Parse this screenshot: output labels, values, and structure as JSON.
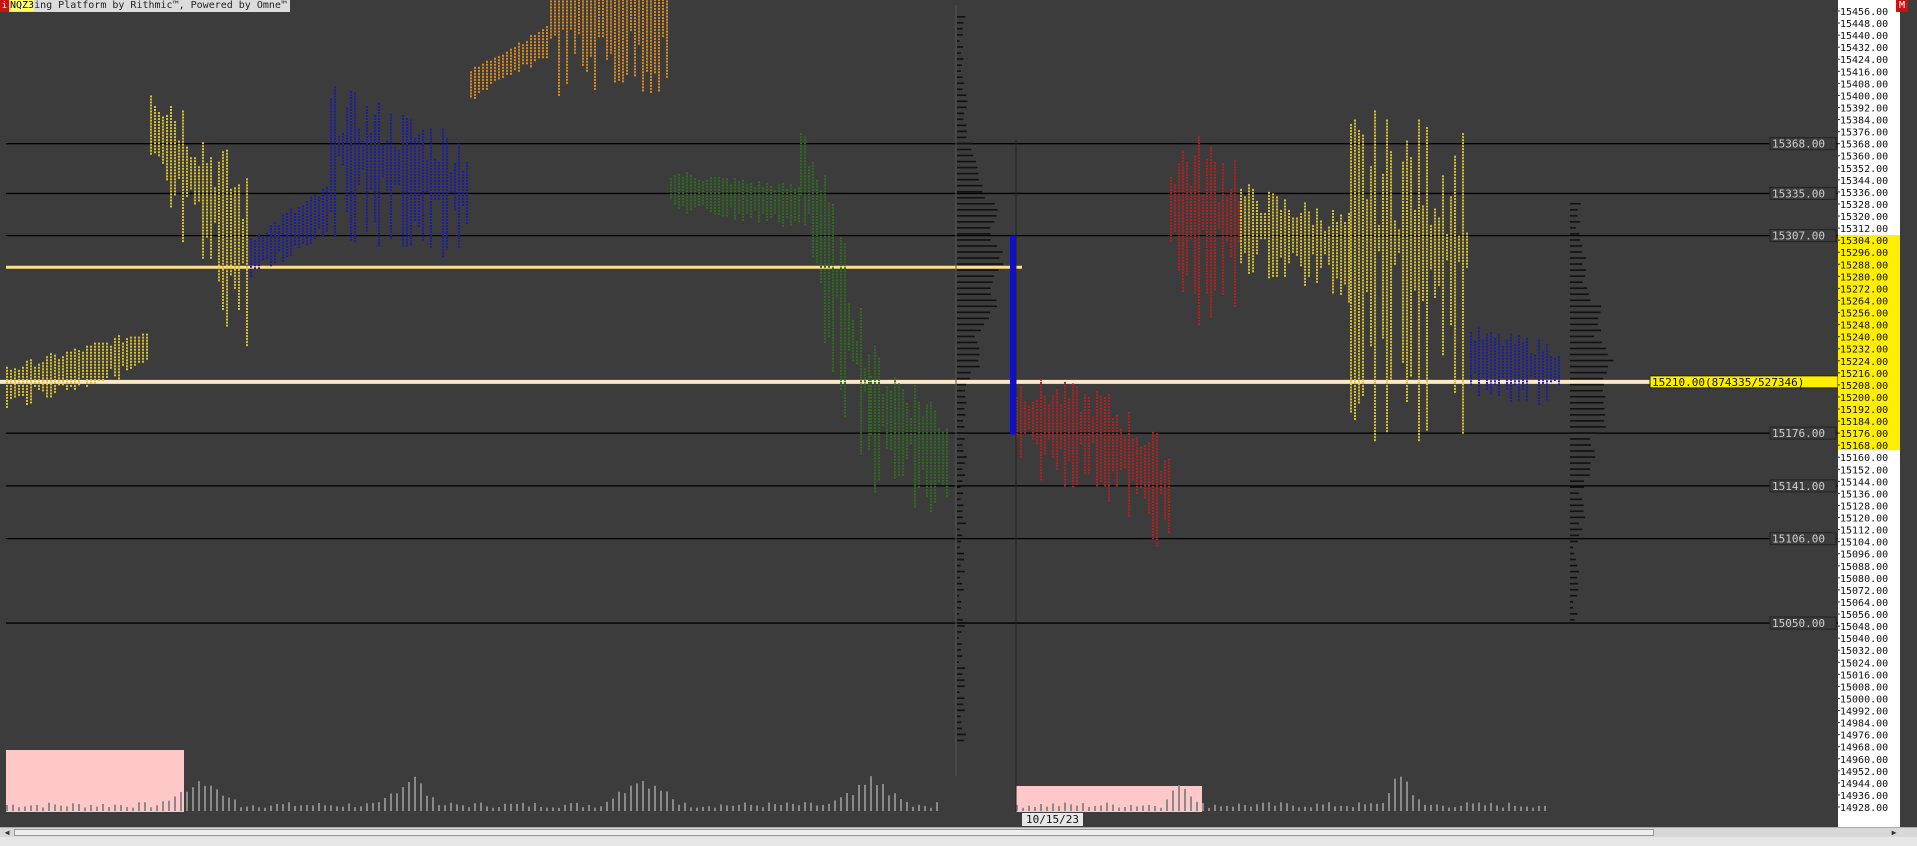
{
  "window": {
    "symbol": "NQZ3",
    "title_rest": "ing Platform by Rithmic™, Powered by Omne™",
    "left_badge": "i",
    "corner_badge": "M"
  },
  "chart": {
    "date_label": "10/15/23",
    "price_axis": {
      "min": 14928,
      "max": 15456,
      "step": 8
    },
    "levels": [
      {
        "price": 15368,
        "label": "15368.00"
      },
      {
        "price": 15335,
        "label": "15335.00"
      },
      {
        "price": 15307,
        "label": "15307.00"
      },
      {
        "price": 15176,
        "label": "15176.00"
      },
      {
        "price": 15141,
        "label": "15141.00"
      },
      {
        "price": 15106,
        "label": "15106.00"
      },
      {
        "price": 15050,
        "label": "15050.00"
      }
    ],
    "poc": {
      "price": 15210,
      "label": "15210.00(874335/527346)"
    },
    "prior_poc_price": 15286,
    "value_area": {
      "low": 15168,
      "high": 15304
    },
    "colors": {
      "background": "#3c3c3c",
      "level_line": "#000000",
      "poc_line": "#ffe8c8",
      "prior_poc_line": "#ffe08a",
      "value_area": "#ffee00",
      "volume_box": "#ffc8c8",
      "ib_bar": "#1010c8"
    },
    "periods": [
      "#d7c12e",
      "#1c1ca8",
      "#d98a1e",
      "#2f6b1e",
      "#b51f1f"
    ]
  }
}
